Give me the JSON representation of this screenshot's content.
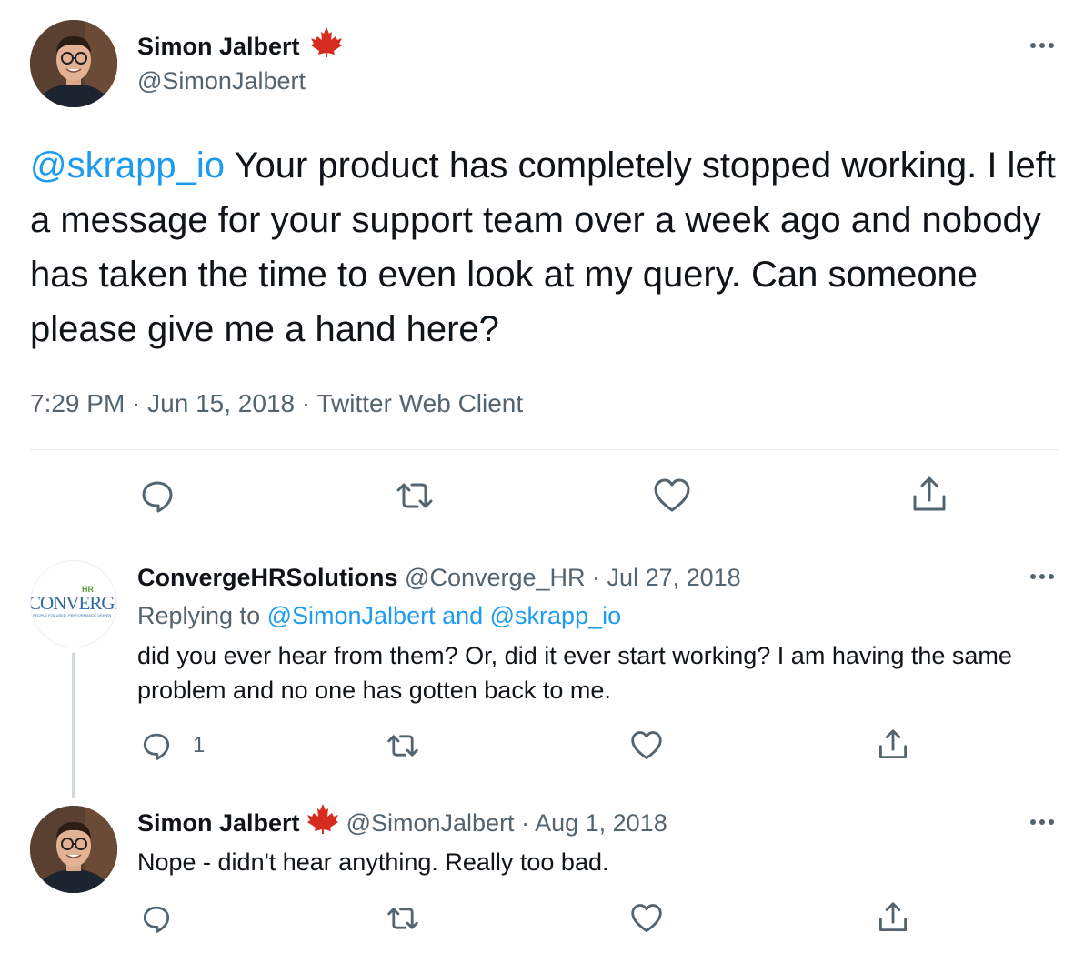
{
  "main_tweet": {
    "author_name": "Simon Jalbert",
    "author_handle": "@SimonJalbert",
    "mention": "@skrapp_io",
    "text": " Your product has completely stopped working. I left a message for your support team over a week ago and nobody has taken the time to even look at my query. Can someone please give me a hand here?",
    "time": "7:29 PM",
    "date": "Jun 15, 2018",
    "client": "Twitter Web Client",
    "sep": " · "
  },
  "reply1": {
    "author_name": "ConvergeHRSolutions",
    "author_handle": "@Converge_HR",
    "date": "Jul 27, 2018",
    "sep": " · ",
    "replying_prefix": "Replying to ",
    "replying_user1": "@SimonJalbert",
    "replying_and": " and ",
    "replying_user2": "@skrapp_io",
    "text": "did you ever hear from them? Or, did it ever start working? I am having the same problem and no one has gotten back to me.",
    "reply_count": "1",
    "logo": {
      "hr": "HR",
      "brand": "CONVERGE",
      "tagline": "PEOPLE FOCUSED. PERFORMANCE DRIVEN"
    }
  },
  "reply2": {
    "author_name": "Simon Jalbert",
    "author_handle": "@SimonJalbert",
    "date": "Aug 1, 2018",
    "sep": " · ",
    "text": "Nope - didn't hear anything. Really too bad."
  },
  "colors": {
    "link": "#1d9bf0",
    "gray": "#536471",
    "flag": "#d62b1e"
  },
  "icons": [
    "maple-leaf-icon",
    "more-icon",
    "reply-icon",
    "retweet-icon",
    "like-icon",
    "share-icon"
  ]
}
